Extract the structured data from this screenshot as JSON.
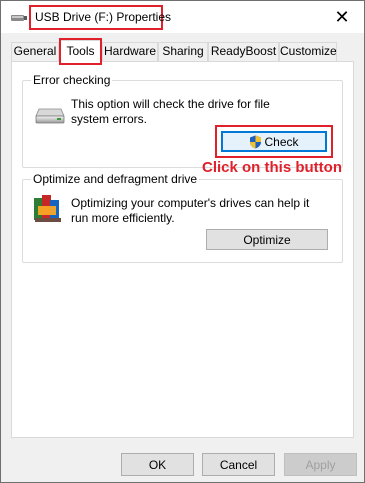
{
  "window": {
    "title": "USB Drive (F:) Properties",
    "close_symbol": "✕"
  },
  "tabs": [
    {
      "label": "General",
      "active": false
    },
    {
      "label": "Tools",
      "active": true
    },
    {
      "label": "Hardware",
      "active": false
    },
    {
      "label": "Sharing",
      "active": false
    },
    {
      "label": "ReadyBoost",
      "active": false
    },
    {
      "label": "Customize",
      "active": false
    }
  ],
  "error_checking": {
    "title": "Error checking",
    "description": "This option will check the drive for file system errors.",
    "button_label": "Check",
    "icon": "drive-icon",
    "button_icon": "uac-shield-icon"
  },
  "annotation": {
    "text": "Click on this button",
    "color": "#e0202a"
  },
  "optimize": {
    "title": "Optimize and defragment drive",
    "description": "Optimizing your computer's drives can help it run more efficiently.",
    "button_label": "Optimize",
    "icon": "defrag-icon"
  },
  "footer": {
    "ok_label": "OK",
    "cancel_label": "Cancel",
    "apply_label": "Apply"
  },
  "colors": {
    "highlight": "#e0202a",
    "accent": "#0078d7"
  }
}
